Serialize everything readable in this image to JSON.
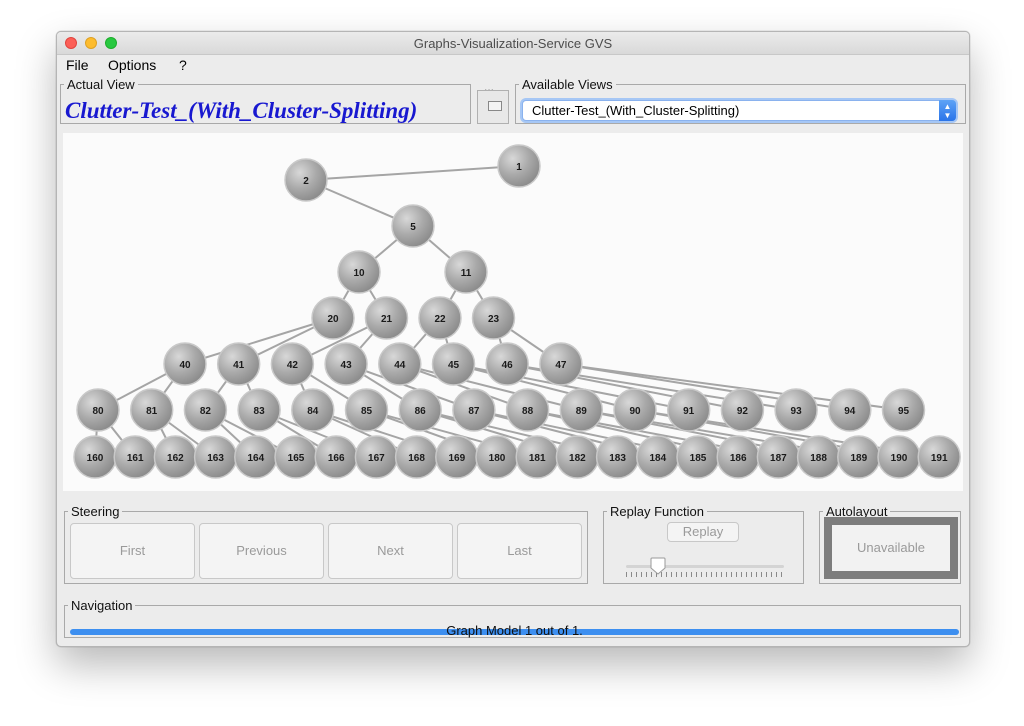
{
  "window": {
    "title": "Graphs-Visualization-Service GVS"
  },
  "menu": {
    "items": [
      "File",
      "Options",
      "?"
    ]
  },
  "actual_view": {
    "legend": "Actual View",
    "value": "Clutter-Test_(With_Cluster-Splitting)"
  },
  "ellipsis_label": "...",
  "available_views": {
    "legend": "Available Views",
    "selected": "Clutter-Test_(With_Cluster-Splitting)"
  },
  "graph": {
    "node_labels": [
      "1",
      "2",
      "5",
      "10",
      "11",
      "20",
      "21",
      "22",
      "23",
      "40",
      "41",
      "42",
      "43",
      "44",
      "45",
      "46",
      "47",
      "80",
      "81",
      "82",
      "83",
      "84",
      "85",
      "86",
      "87",
      "88",
      "89",
      "90",
      "91",
      "92",
      "93",
      "94",
      "95",
      "160",
      "161",
      "162",
      "163",
      "164",
      "165",
      "166",
      "167",
      "168",
      "169",
      "180",
      "181",
      "182",
      "183",
      "184",
      "185",
      "186",
      "187",
      "188",
      "189",
      "190",
      "191"
    ],
    "edges": [
      [
        "2",
        "1"
      ],
      [
        "2",
        "5"
      ],
      [
        "5",
        "10"
      ],
      [
        "5",
        "11"
      ],
      [
        "10",
        "20"
      ],
      [
        "10",
        "21"
      ],
      [
        "11",
        "22"
      ],
      [
        "11",
        "23"
      ],
      [
        "20",
        "40"
      ],
      [
        "20",
        "41"
      ],
      [
        "21",
        "42"
      ],
      [
        "21",
        "43"
      ],
      [
        "22",
        "44"
      ],
      [
        "22",
        "45"
      ],
      [
        "23",
        "46"
      ],
      [
        "23",
        "47"
      ],
      [
        "40",
        "80"
      ],
      [
        "40",
        "81"
      ],
      [
        "41",
        "82"
      ],
      [
        "41",
        "83"
      ],
      [
        "42",
        "84"
      ],
      [
        "42",
        "85"
      ],
      [
        "43",
        "86"
      ],
      [
        "43",
        "87"
      ],
      [
        "44",
        "88"
      ],
      [
        "44",
        "89"
      ],
      [
        "45",
        "90"
      ],
      [
        "45",
        "91"
      ],
      [
        "46",
        "92"
      ],
      [
        "46",
        "93"
      ],
      [
        "47",
        "94"
      ],
      [
        "47",
        "95"
      ],
      [
        "80",
        "160"
      ],
      [
        "80",
        "161"
      ],
      [
        "81",
        "162"
      ],
      [
        "81",
        "163"
      ],
      [
        "82",
        "164"
      ],
      [
        "82",
        "165"
      ],
      [
        "83",
        "166"
      ],
      [
        "83",
        "167"
      ],
      [
        "84",
        "168"
      ],
      [
        "84",
        "169"
      ],
      [
        "85",
        "180"
      ],
      [
        "85",
        "181"
      ],
      [
        "86",
        "182"
      ],
      [
        "86",
        "183"
      ],
      [
        "87",
        "184"
      ],
      [
        "87",
        "185"
      ],
      [
        "88",
        "186"
      ],
      [
        "88",
        "187"
      ],
      [
        "89",
        "188"
      ],
      [
        "89",
        "189"
      ],
      [
        "90",
        "190"
      ],
      [
        "90",
        "191"
      ]
    ]
  },
  "steering": {
    "legend": "Steering",
    "buttons": [
      "First",
      "Previous",
      "Next",
      "Last"
    ]
  },
  "replay": {
    "legend": "Replay Function",
    "button": "Replay",
    "slider_position": 0.2
  },
  "autolayout": {
    "legend": "Autolayout",
    "button": "Unavailable"
  },
  "navigation": {
    "legend": "Navigation",
    "status": "Graph Model 1 out of 1.",
    "progress": 1.0
  },
  "colors": {
    "title_blue": "#1818d0",
    "progress_blue": "#3d8ff0",
    "node_gray": "#a8a8a8"
  }
}
